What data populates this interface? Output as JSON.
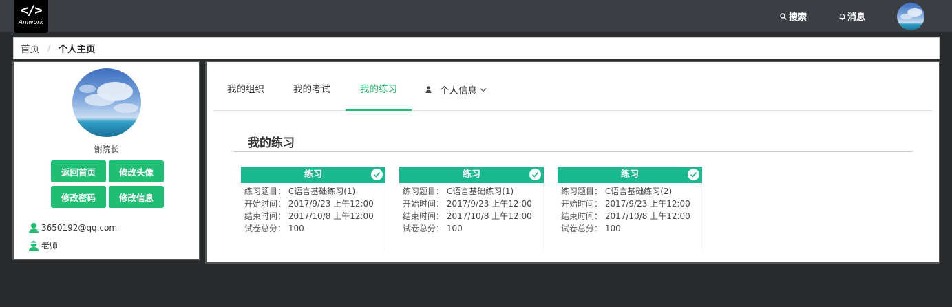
{
  "brand": {
    "logo_glyph": "</>",
    "logo_word": "Aniwork"
  },
  "nav": {
    "search_label": "搜索",
    "message_label": "消息"
  },
  "breadcrumb": {
    "home": "首页",
    "separator": "/",
    "current": "个人主页"
  },
  "profile": {
    "name": "谢院长",
    "buttons": {
      "home": "返回首页",
      "avatar": "修改头像",
      "password": "修改密码",
      "info": "修改信息"
    },
    "email": "3650192@qq.com",
    "role": "老师"
  },
  "tabs": {
    "org": "我的组织",
    "exam": "我的考试",
    "practice": "我的练习",
    "personal": "个人信息",
    "active": "practice"
  },
  "section": {
    "title": "我的练习"
  },
  "cards": [
    {
      "header": "练习",
      "title_label": "练习题目：",
      "title": "C语言基础练习(1)",
      "start_label": "开始时间：",
      "start": "2017/9/23 上午12:00",
      "end_label": "结束时间：",
      "end": "2017/10/8 上午12:00",
      "score_label": "试卷总分：",
      "score": "100"
    },
    {
      "header": "练习",
      "title_label": "练习题目：",
      "title": "C语言基础练习(1)",
      "start_label": "开始时间：",
      "start": "2017/9/23 上午12:00",
      "end_label": "结束时间：",
      "end": "2017/10/8 上午12:00",
      "score_label": "试卷总分：",
      "score": "100"
    },
    {
      "header": "练习",
      "title_label": "练习题目：",
      "title": "C语言基础练习(2)",
      "start_label": "开始时间：",
      "start": "2017/9/23 上午12:00",
      "end_label": "结束时间：",
      "end": "2017/10/8 上午12:00",
      "score_label": "试卷总分：",
      "score": "100"
    }
  ],
  "colors": {
    "accent": "#1fbe72",
    "card_header": "#19b98f",
    "navbar": "#3b3f44",
    "page_bg": "#2a2b2c"
  },
  "icons": {
    "search": "search-icon",
    "message": "bell-icon",
    "email": "user-icon",
    "role": "teacher-icon",
    "check": "check-icon",
    "dropdown": "chevron-down-icon"
  }
}
